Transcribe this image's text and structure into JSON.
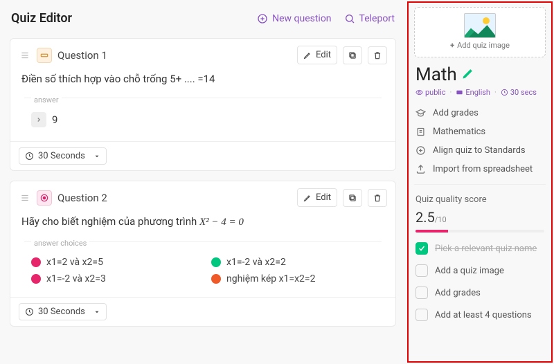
{
  "header": {
    "title": "Quiz Editor",
    "new_question": "New question",
    "teleport": "Teleport"
  },
  "questions": [
    {
      "title": "Question 1",
      "edit": "Edit",
      "body": "Điền số thích hợp vào chỗ trống 5+ .... =14",
      "answer_legend": "answer",
      "answer": "9",
      "time": "30 Seconds"
    },
    {
      "title": "Question 2",
      "edit": "Edit",
      "body_prefix": "Hãy cho biết nghiệm của phương trình ",
      "equation": "X² − 4 = 0",
      "choices_legend": "answer choices",
      "choices": [
        "x1=2 và x2=5",
        "x1=-2 và x2=2",
        "x1=-2 và x2=3",
        "nghiệm kép x1=x2=2"
      ],
      "time": "30 Seconds"
    }
  ],
  "sidebar": {
    "add_image": "Add quiz image",
    "quiz_name": "Math",
    "meta": {
      "visibility": "public",
      "language": "English",
      "duration": "30 secs"
    },
    "links": {
      "grades": "Add grades",
      "subject": "Mathematics",
      "standards": "Align quiz to Standards",
      "import": "Import from spreadsheet"
    },
    "quality": {
      "title": "Quiz quality score",
      "score": "2.5",
      "denom": "/10",
      "items": [
        {
          "label": "Pick a relevant quiz name",
          "done": true
        },
        {
          "label": "Add a quiz image",
          "done": false
        },
        {
          "label": "Add grades",
          "done": false
        },
        {
          "label": "Add at least 4 questions",
          "done": false
        }
      ]
    }
  }
}
